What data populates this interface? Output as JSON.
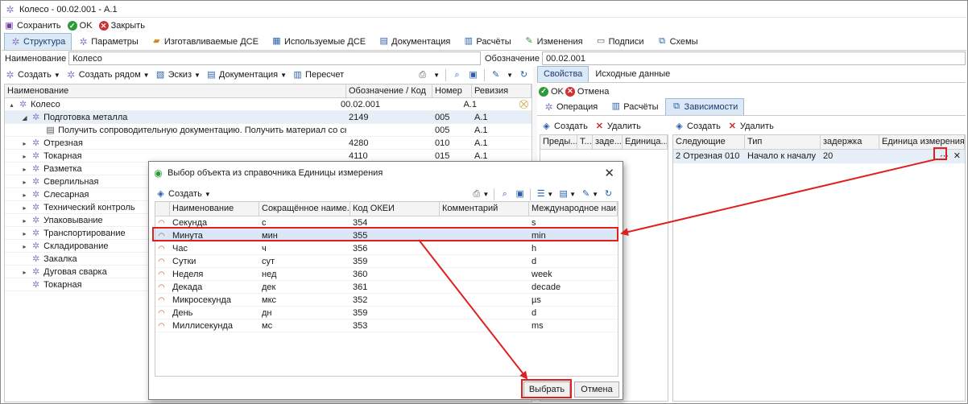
{
  "window": {
    "title": "Колесо - 00.02.001 - A.1"
  },
  "toolbar": {
    "save": "Сохранить",
    "ok": "OK",
    "close": "Закрыть"
  },
  "tabs": [
    {
      "label": "Структура",
      "icon": "gear-icon",
      "active": true
    },
    {
      "label": "Параметры",
      "icon": "gear-icon"
    },
    {
      "label": "Изготавливаемые ДСЕ",
      "icon": "folder-icon"
    },
    {
      "label": "Используемые ДСЕ",
      "icon": "grid-icon"
    },
    {
      "label": "Документация",
      "icon": "document-icon"
    },
    {
      "label": "Расчёты",
      "icon": "calc-icon"
    },
    {
      "label": "Изменения",
      "icon": "changes-icon"
    },
    {
      "label": "Подписи",
      "icon": "sign-icon"
    },
    {
      "label": "Схемы",
      "icon": "scheme-icon"
    }
  ],
  "fields": {
    "name_label": "Наименование",
    "name_value": "Колесо",
    "designation_label": "Обозначение",
    "designation_value": "00.02.001"
  },
  "toolbar2": {
    "create": "Создать",
    "create_near": "Создать рядом",
    "sketch": "Эскиз",
    "documentation": "Документация",
    "recalc": "Пересчет"
  },
  "tree": {
    "columns": [
      "Наименование",
      "Обозначение / Код",
      "Номер",
      "Ревизия"
    ],
    "rows": [
      {
        "name": "Колесо",
        "code": "00.02.001",
        "num": "",
        "rev": "A.1",
        "level": 0,
        "expander": "▴"
      },
      {
        "name": "Подготовка металла",
        "code": "2149",
        "num": "005",
        "rev": "A.1",
        "level": 1,
        "expander": "◢"
      },
      {
        "name": "Получить сопроводительную документацию. Получить материал со склада.",
        "code": "",
        "num": "005",
        "rev": "A.1",
        "level": 2,
        "expander": ""
      },
      {
        "name": "Отрезная",
        "code": "4280",
        "num": "010",
        "rev": "A.1",
        "level": 1,
        "expander": "▸"
      },
      {
        "name": "Токарная",
        "code": "4110",
        "num": "015",
        "rev": "A.1",
        "level": 1,
        "expander": "▸"
      },
      {
        "name": "Разметка",
        "code": "",
        "num": "",
        "rev": "",
        "level": 1,
        "expander": "▸"
      },
      {
        "name": "Сверлильная",
        "code": "",
        "num": "",
        "rev": "",
        "level": 1,
        "expander": "▸"
      },
      {
        "name": "Слесарная",
        "code": "",
        "num": "",
        "rev": "",
        "level": 1,
        "expander": "▸"
      },
      {
        "name": "Технический контроль",
        "code": "",
        "num": "",
        "rev": "",
        "level": 1,
        "expander": "▸"
      },
      {
        "name": "Упаковывание",
        "code": "",
        "num": "",
        "rev": "",
        "level": 1,
        "expander": "▸"
      },
      {
        "name": "Транспортирование",
        "code": "",
        "num": "",
        "rev": "",
        "level": 1,
        "expander": "▸"
      },
      {
        "name": "Складирование",
        "code": "",
        "num": "",
        "rev": "",
        "level": 1,
        "expander": "▸"
      },
      {
        "name": "Закалка",
        "code": "",
        "num": "",
        "rev": "",
        "level": 1,
        "expander": ""
      },
      {
        "name": "Дуговая сварка",
        "code": "",
        "num": "",
        "rev": "",
        "level": 1,
        "expander": "▸"
      },
      {
        "name": "Токарная",
        "code": "",
        "num": "",
        "rev": "",
        "level": 1,
        "expander": ""
      }
    ]
  },
  "right": {
    "tabs": [
      "Свойства",
      "Исходные данные"
    ],
    "ok": "OK",
    "cancel": "Отмена",
    "subtabs": [
      "Операция",
      "Расчёты",
      "Зависимости"
    ],
    "create": "Создать",
    "delete": "Удалить",
    "prev_cols": [
      "Преды...",
      "Т...",
      "заде...",
      "Единица..."
    ],
    "next_cols": [
      "Следующие",
      "Тип",
      "задержка",
      "Единица измерения"
    ],
    "next_row": {
      "next": "2 Отрезная 010",
      "type": "Начало к началу",
      "delay": "20",
      "unit": ""
    }
  },
  "dialog": {
    "title": "Выбор объекта из справочника Единицы измерения",
    "create": "Создать",
    "columns": [
      "Наименование",
      "Сокращённое наиме...",
      "Код ОКЕИ",
      "Комментарий",
      "Международное наи..."
    ],
    "rows": [
      {
        "name": "Секунда",
        "short": "с",
        "code": "354",
        "comment": "",
        "intl": "s"
      },
      {
        "name": "Минута",
        "short": "мин",
        "code": "355",
        "comment": "",
        "intl": "min"
      },
      {
        "name": "Час",
        "short": "ч",
        "code": "356",
        "comment": "",
        "intl": "h"
      },
      {
        "name": "Сутки",
        "short": "сут",
        "code": "359",
        "comment": "",
        "intl": "d"
      },
      {
        "name": "Неделя",
        "short": "нед",
        "code": "360",
        "comment": "",
        "intl": "week"
      },
      {
        "name": "Декада",
        "short": "дек",
        "code": "361",
        "comment": "",
        "intl": "decade"
      },
      {
        "name": "Микросекунда",
        "short": "мкс",
        "code": "352",
        "comment": "",
        "intl": "µs"
      },
      {
        "name": "День",
        "short": "дн",
        "code": "359",
        "comment": "",
        "intl": "d"
      },
      {
        "name": "Миллисекунда",
        "short": "мс",
        "code": "353",
        "comment": "",
        "intl": "ms"
      }
    ],
    "select": "Выбрать",
    "cancel": "Отмена"
  },
  "colors": {
    "accent": "#e02020",
    "selected_row": "#d9e7f6",
    "tab_active": "#dbe8f5"
  }
}
